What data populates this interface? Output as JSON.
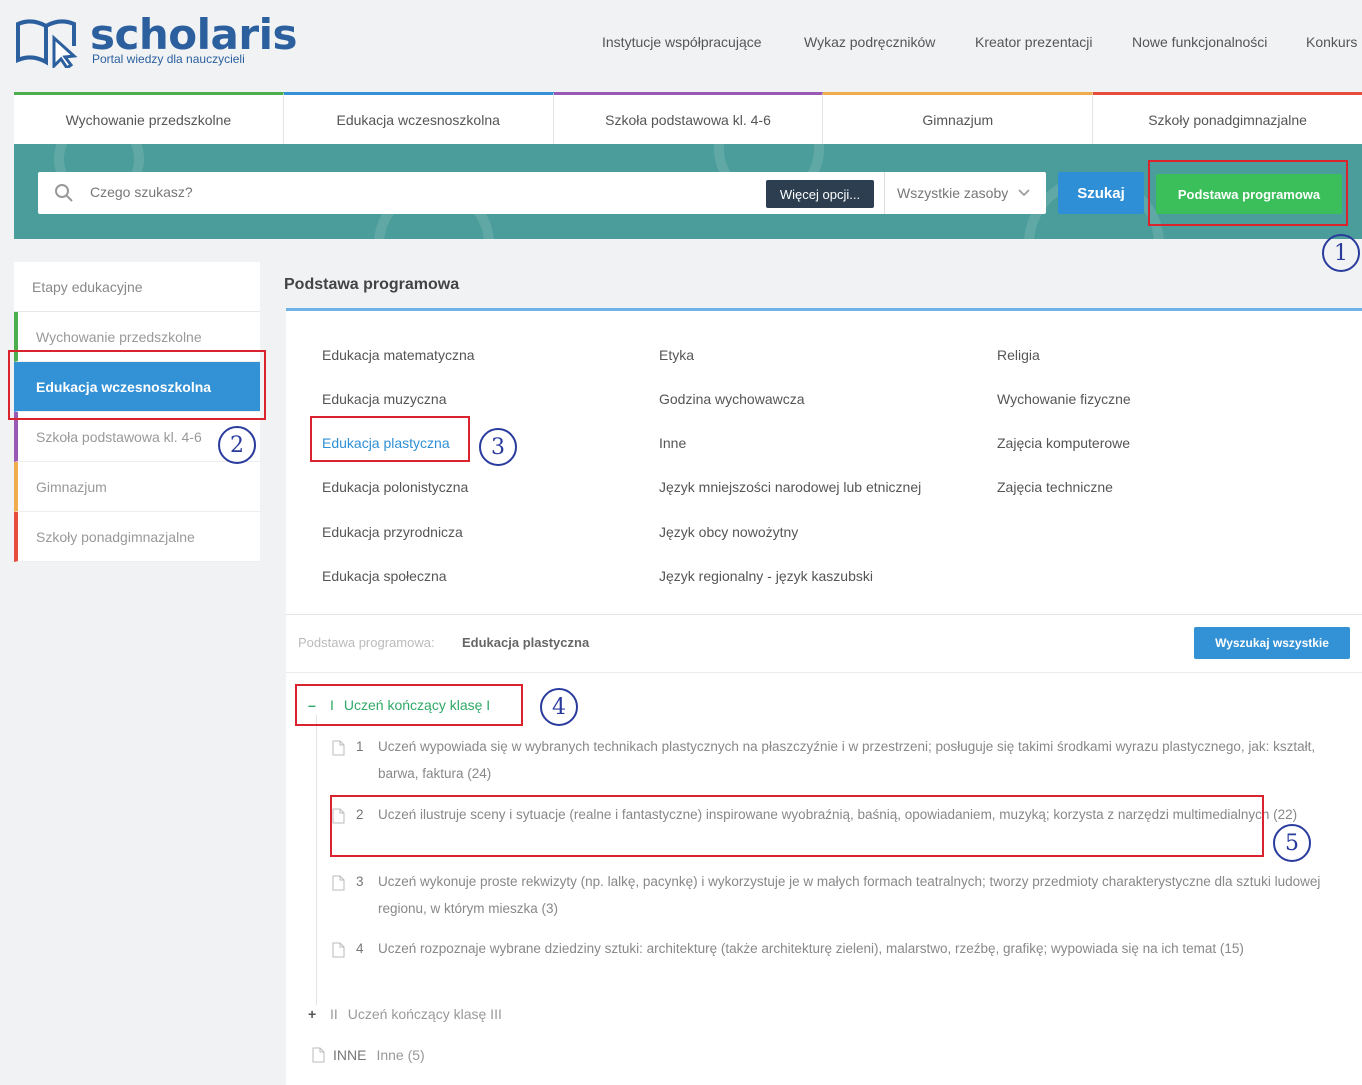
{
  "logo": {
    "brand": "scholaris",
    "tagline": "Portal wiedzy dla nauczycieli"
  },
  "top_nav": [
    "Instytucje współpracujące",
    "Wykaz podręczników",
    "Kreator prezentacji",
    "Nowe funkcjonalności",
    "Konkurs"
  ],
  "level_tabs": [
    {
      "label": "Wychowanie przedszkolne",
      "color": "#4cae4c"
    },
    {
      "label": "Edukacja wczesnoszkolna",
      "color": "#3391d6"
    },
    {
      "label": "Szkoła podstawowa kl. 4-6",
      "color": "#9b59b6"
    },
    {
      "label": "Gimnazjum",
      "color": "#f0ad4e"
    },
    {
      "label": "Szkoły ponadgimnazjalne",
      "color": "#e74c3c"
    }
  ],
  "search": {
    "placeholder": "Czego szukasz?",
    "more_options": "Więcej opcji...",
    "resources": "Wszystkie zasoby",
    "submit": "Szukaj",
    "curriculum_button": "Podstawa programowa"
  },
  "sidebar": {
    "header": "Etapy edukacyjne",
    "items": [
      {
        "label": "Wychowanie przedszkolne",
        "color": "#4cae4c"
      },
      {
        "label": "Edukacja wczesnoszkolna",
        "color": "#3391d6",
        "active": true
      },
      {
        "label": "Szkoła podstawowa kl. 4-6",
        "color": "#9b59b6"
      },
      {
        "label": "Gimnazjum",
        "color": "#f0ad4e"
      },
      {
        "label": "Szkoły ponadgimnazjalne",
        "color": "#e74c3c"
      }
    ]
  },
  "main": {
    "title": "Podstawa programowa",
    "subjects": [
      [
        "Edukacja matematyczna",
        "Edukacja muzyczna",
        "Edukacja plastyczna",
        "Edukacja polonistyczna",
        "Edukacja przyrodnicza",
        "Edukacja społeczna"
      ],
      [
        "Etyka",
        "Godzina wychowawcza",
        "Inne",
        "Język mniejszości narodowej lub etnicznej",
        "Język obcy nowożytny",
        "Język regionalny - język kaszubski"
      ],
      [
        "Religia",
        "Wychowanie fizyczne",
        "Zajęcia komputerowe",
        "Zajęcia techniczne"
      ]
    ],
    "selected_subject": "Edukacja plastyczna",
    "crumb_label": "Podstawa programowa:",
    "crumb_value": "Edukacja plastyczna",
    "search_all": "Wyszukaj wszystkie"
  },
  "tree": {
    "open_node": {
      "toggle": "–",
      "roman": "I",
      "label": "Uczeń kończący klasę I"
    },
    "leaves": [
      {
        "num": "1",
        "text": "Uczeń wypowiada się w wybranych technikach plastycznych na płaszczyźnie i w przestrzeni; posługuje się takimi środkami wyrazu plastycznego, jak: kształt, barwa, faktura (24)"
      },
      {
        "num": "2",
        "text": "Uczeń ilustruje sceny i sytuacje (realne i fantastyczne) inspirowane wyobraźnią, baśnią, opowiadaniem, muzyką; korzysta z narzędzi multimedialnych (22)"
      },
      {
        "num": "3",
        "text": "Uczeń wykonuje proste rekwizyty (np. lalkę, pacynkę) i wykorzystuje je w małych formach teatralnych; tworzy przedmioty charakterystyczne dla sztuki ludowej regionu, w którym mieszka (3)"
      },
      {
        "num": "4",
        "text": "Uczeń rozpoznaje wybrane dziedziny sztuki: architekturę (także architekturę zieleni), malarstwo, rzeźbę, grafikę; wypowiada się na ich temat (15)"
      }
    ],
    "closed_node": {
      "toggle": "+",
      "roman": "II",
      "label": "Uczeń kończący klasę III"
    },
    "other": {
      "code": "INNE",
      "label": "Inne (5)"
    }
  },
  "annotations": [
    "1",
    "2",
    "3",
    "4",
    "5"
  ]
}
